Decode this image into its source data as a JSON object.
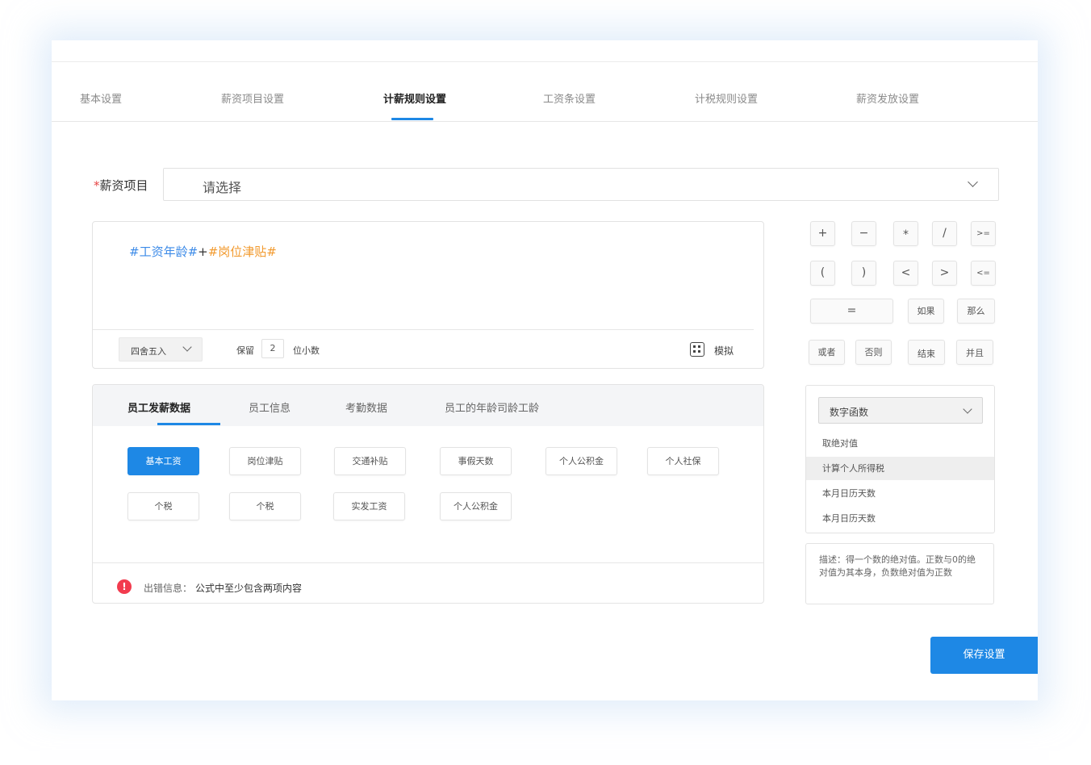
{
  "tabs": [
    "基本设置",
    "薪资项目设置",
    "计薪规则设置",
    "工资条设置",
    "计税规则设置",
    "薪资发放设置"
  ],
  "active_tab": "计薪规则设置",
  "salary_item": {
    "required_mark": "*",
    "label": "薪资项目",
    "placeholder": "请选择"
  },
  "formula": {
    "part1": "#工资年龄#",
    "operator": "+",
    "part2": "#岗位津贴#"
  },
  "rounding": {
    "mode": "四舍五入",
    "keep_label": "保留",
    "decimals": "2",
    "decimal_label": "位小数",
    "simulate_label": "模拟"
  },
  "operators": [
    "+",
    "−",
    "*",
    "/",
    ">=",
    "(",
    ")",
    "<",
    ">",
    "<=",
    "=",
    "如果",
    "那么",
    "或者",
    "否则",
    "结束",
    "并且"
  ],
  "data_tabs": [
    "员工发薪数据",
    "员工信息",
    "考勤数据",
    "员工的年龄司龄工龄"
  ],
  "active_data_tab": "员工发薪数据",
  "data_items": [
    "基本工资",
    "岗位津贴",
    "交通补贴",
    "事假天数",
    "个人公积金",
    "个人社保",
    "个税",
    "个税",
    "实发工资",
    "个人公积金"
  ],
  "active_data_item": "基本工资",
  "error": {
    "label": "出错信息：",
    "message": "公式中至少包含两项内容"
  },
  "functions": {
    "category": "数字函数",
    "items": [
      "取绝对值",
      "计算个人所得税",
      "本月日历天数",
      "本月日历天数"
    ],
    "highlighted": "计算个人所得税"
  },
  "description": "描述：得一个数的绝对值。正数与0的绝对值为其本身，负数绝对值为正数",
  "save_label": "保存设置",
  "colors": {
    "primary": "#1e88e5",
    "formula_field": "#3d8be8",
    "formula_field_2": "#f29a2e",
    "error": "#f23b4e",
    "required": "#e64545"
  },
  "icons": {
    "dropdown": "chevron-down-icon",
    "simulate": "calculator-icon",
    "error": "error-icon"
  }
}
